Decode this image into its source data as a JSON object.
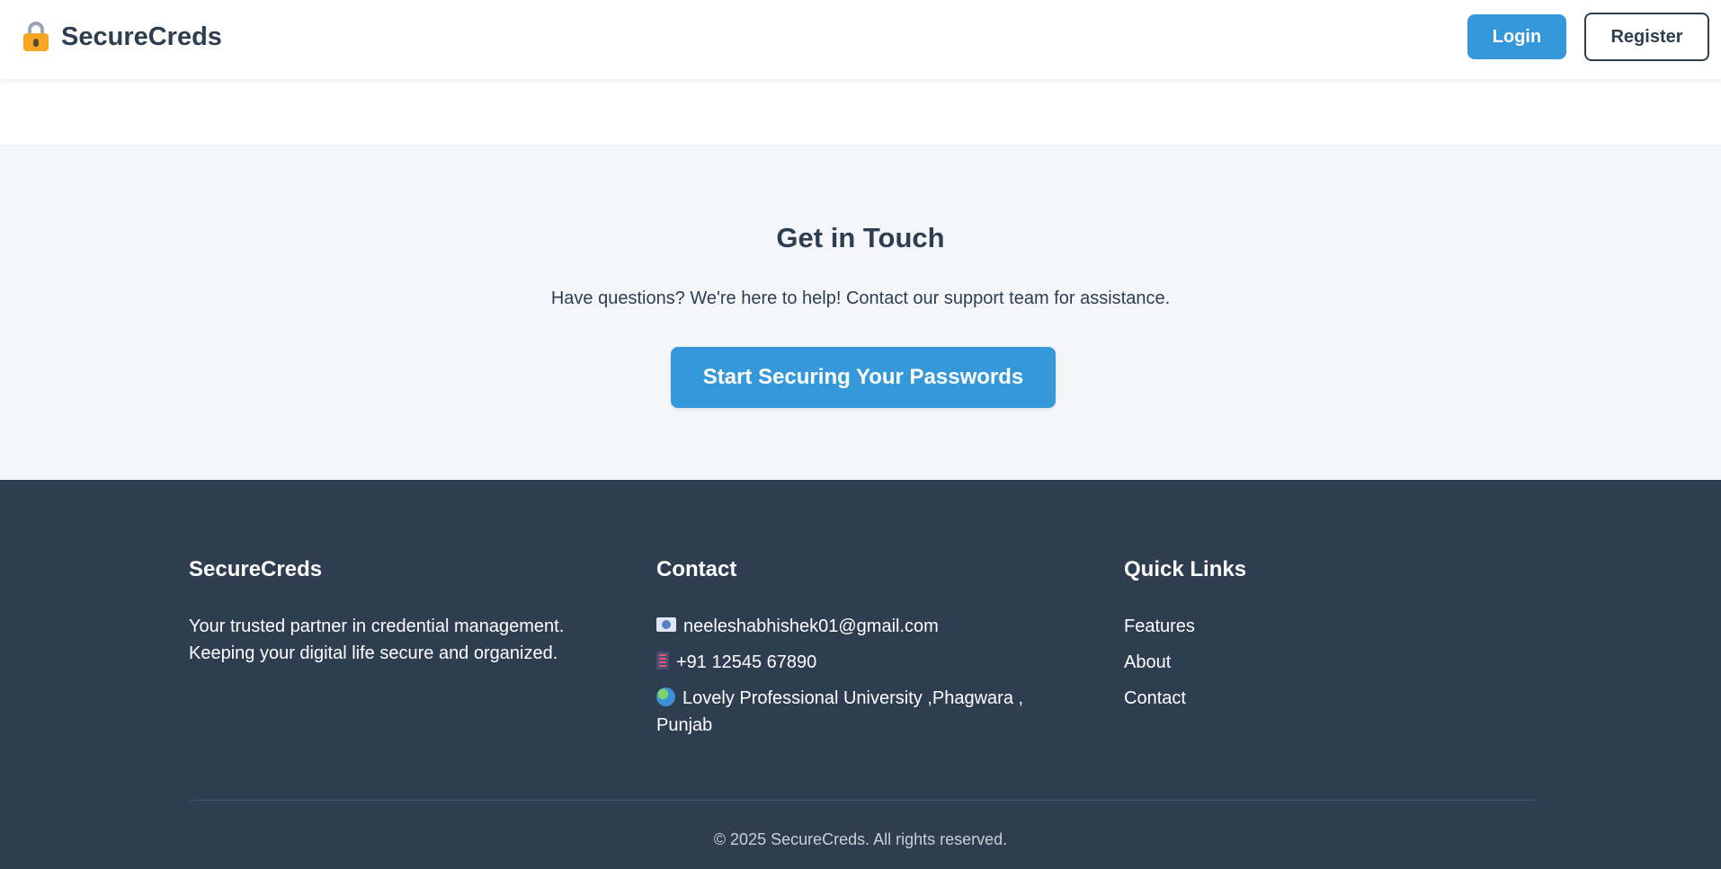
{
  "header": {
    "brand": "SecureCreds",
    "brand_icon": "lock-icon",
    "login_label": "Login",
    "register_label": "Register"
  },
  "cta": {
    "title": "Get in Touch",
    "text": "Have questions? We're here to help! Contact our support team for assistance.",
    "button_label": "Start Securing Your Passwords"
  },
  "footer": {
    "about": {
      "heading": "SecureCreds",
      "text_line1": "Your trusted partner in credential management.",
      "text_line2": "Keeping your digital life secure and organized."
    },
    "contact": {
      "heading": "Contact",
      "email": "neeleshabhishek01@gmail.com",
      "email_icon": "email-icon",
      "phone": "+91 12545 67890",
      "phone_icon": "phone-icon",
      "address": "Lovely Professional University ,Phagwara , Punjab",
      "address_icon": "globe-icon"
    },
    "links": {
      "heading": "Quick Links",
      "items": [
        "Features",
        "About",
        "Contact"
      ]
    },
    "copyright": "© 2025 SecureCreds. All rights reserved."
  },
  "colors": {
    "accent": "#3498db",
    "dark": "#2c3e50",
    "footer_bg": "#2e3e50",
    "section_bg": "#f5f6f9"
  }
}
